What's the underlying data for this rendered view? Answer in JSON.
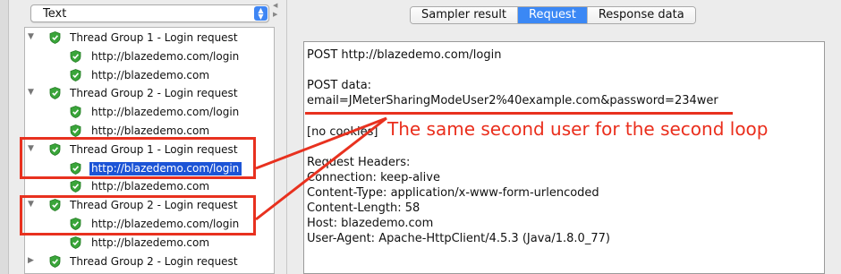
{
  "results_combo": {
    "value": "Text"
  },
  "tree": {
    "rows": [
      {
        "kind": "group",
        "label": "Thread Group 1 - Login request",
        "arrow": "▼"
      },
      {
        "kind": "child",
        "label": "http://blazedemo.com/login"
      },
      {
        "kind": "child",
        "label": "http://blazedemo.com"
      },
      {
        "kind": "group",
        "label": "Thread Group 2 - Login request",
        "arrow": "▼"
      },
      {
        "kind": "child",
        "label": "http://blazedemo.com/login"
      },
      {
        "kind": "child",
        "label": "http://blazedemo.com"
      },
      {
        "kind": "group",
        "label": "Thread Group 1 - Login request",
        "arrow": "▼"
      },
      {
        "kind": "child",
        "label": "http://blazedemo.com/login",
        "selected": true
      },
      {
        "kind": "child",
        "label": "http://blazedemo.com"
      },
      {
        "kind": "group",
        "label": "Thread Group 2 - Login request",
        "arrow": "▼"
      },
      {
        "kind": "child",
        "label": "http://blazedemo.com/login"
      },
      {
        "kind": "child",
        "label": "http://blazedemo.com"
      },
      {
        "kind": "group",
        "label": "Thread Group 2 - Login request",
        "arrow": "▶"
      }
    ]
  },
  "tabs": {
    "sampler_result": "Sampler result",
    "request": "Request",
    "response_data": "Response data"
  },
  "request_text": {
    "line1": "POST http://blazedemo.com/login",
    "line2": "POST data:",
    "line3": "email=JMeterSharingModeUser2%40example.com&password=234wer",
    "line4": "[no cookies]",
    "line5": "Request Headers:",
    "line6": "Connection: keep-alive",
    "line7": "Content-Type: application/x-www-form-urlencoded",
    "line8": "Content-Length: 58",
    "line9": "Host: blazedemo.com",
    "line10": "User-Agent: Apache-HttpClient/4.5.3 (Java/1.8.0_77)"
  },
  "annotation": {
    "text": "The same second user for the second loop"
  },
  "colors": {
    "accent": "#3b88f5",
    "annotation_red": "#e8311f",
    "selection": "#1c54d6",
    "shield_green": "#3aa53a"
  }
}
